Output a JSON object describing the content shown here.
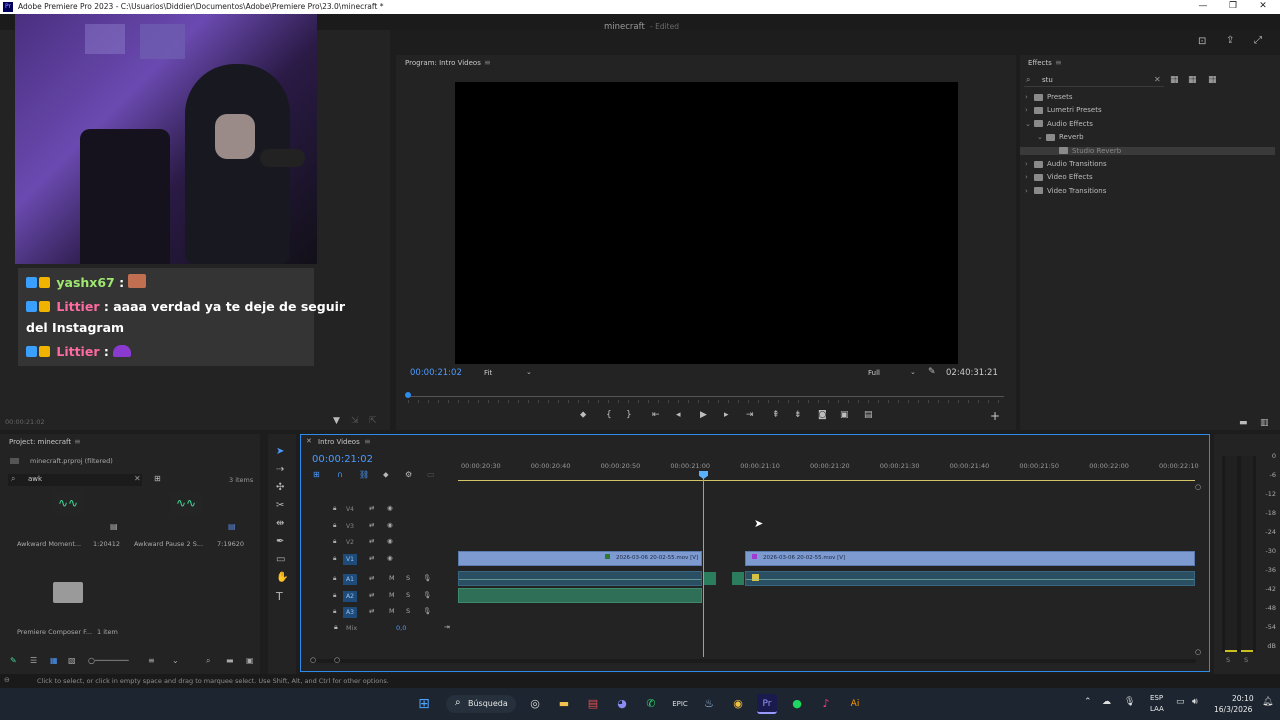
{
  "window": {
    "title": "Adobe Premiere Pro 2023 - C:\\Usuarios\\Diddier\\Documentos\\Adobe\\Premiere Pro\\23.0\\minecraft *",
    "logo_text": "Pr",
    "minimize": "—",
    "restore": "❐",
    "close": "✕"
  },
  "header": {
    "project_name": "minecraft",
    "edited_label": "- Edited"
  },
  "program_monitor": {
    "title": "Program: Intro Videos",
    "timecode": "00:00:21:02",
    "fit": "Fit",
    "quality": "Full",
    "duration": "02:40:31:21"
  },
  "source_panel": {
    "timecode": "00:00:21:02"
  },
  "effects": {
    "title": "Effects",
    "search_value": "stu",
    "items": [
      {
        "label": "Presets",
        "indent": 0
      },
      {
        "label": "Lumetri Presets",
        "indent": 0
      },
      {
        "label": "Audio Effects",
        "indent": 0
      },
      {
        "label": "Reverb",
        "indent": 1
      },
      {
        "label": "Studio Reverb",
        "indent": 2
      },
      {
        "label": "Audio Transitions",
        "indent": 0
      },
      {
        "label": "Video Effects",
        "indent": 0
      },
      {
        "label": "Video Transitions",
        "indent": 0
      }
    ]
  },
  "project": {
    "title": "Project: minecraft",
    "filename": "minecraft.prproj (filtered)",
    "search_value": "awk",
    "item_count": "3 items",
    "items": [
      {
        "name": "Awkward Moment...",
        "duration": "1:20412"
      },
      {
        "name": "Awkward Pause 2 S...",
        "duration": "7:19620"
      }
    ],
    "bin": {
      "name": "Premiere Composer F...",
      "count": "1 item"
    }
  },
  "timeline": {
    "tab": "Intro Videos",
    "timecode": "00:00:21:02",
    "ruler": [
      "00:00:20:30",
      "00:00:20:40",
      "00:00:20:50",
      "00:00:21:00",
      "00:00:21:10",
      "00:00:21:20",
      "00:00:21:30",
      "00:00:21:40",
      "00:00:21:50",
      "00:00:22:00",
      "00:00:22:10"
    ],
    "video_tracks": [
      "V4",
      "V3",
      "V2",
      "V1"
    ],
    "audio_tracks": [
      "A1",
      "A2",
      "A3"
    ],
    "mix_label": "Mix",
    "mix_value": "0,0",
    "clip1": "2026-03-06 20-02-55.mov [V]",
    "clip2": "2026-03-06 20-02-55.mov [V]",
    "track_m": "M",
    "track_s": "S"
  },
  "meter": {
    "scale": [
      "0",
      "-6",
      "-12",
      "-18",
      "-24",
      "-30",
      "-36",
      "-42",
      "-48",
      "-54",
      "dB"
    ],
    "solo_left": "S",
    "solo_right": "S"
  },
  "status": {
    "text": "Click to select, or click in empty space and drag to marquee select. Use Shift, Alt, and Ctrl for other options."
  },
  "chat": {
    "line1_user": "yashx67",
    "line1_sep": ":",
    "line2_user": "Littier",
    "line2_text": ": aaaa verdad ya te deje de seguir",
    "line3_text": "del Instagram",
    "line4_user": "Littier",
    "line4_sep": ":"
  },
  "taskbar": {
    "search_label": "Búsqueda",
    "language_top": "ESP",
    "language_bottom": "LAA",
    "time": "20:10",
    "date": "16/3/2026"
  },
  "colors": {
    "accent": "#2d8ceb",
    "clip_video": "#7d9bd0",
    "clip_audio": "#2f6f58"
  }
}
